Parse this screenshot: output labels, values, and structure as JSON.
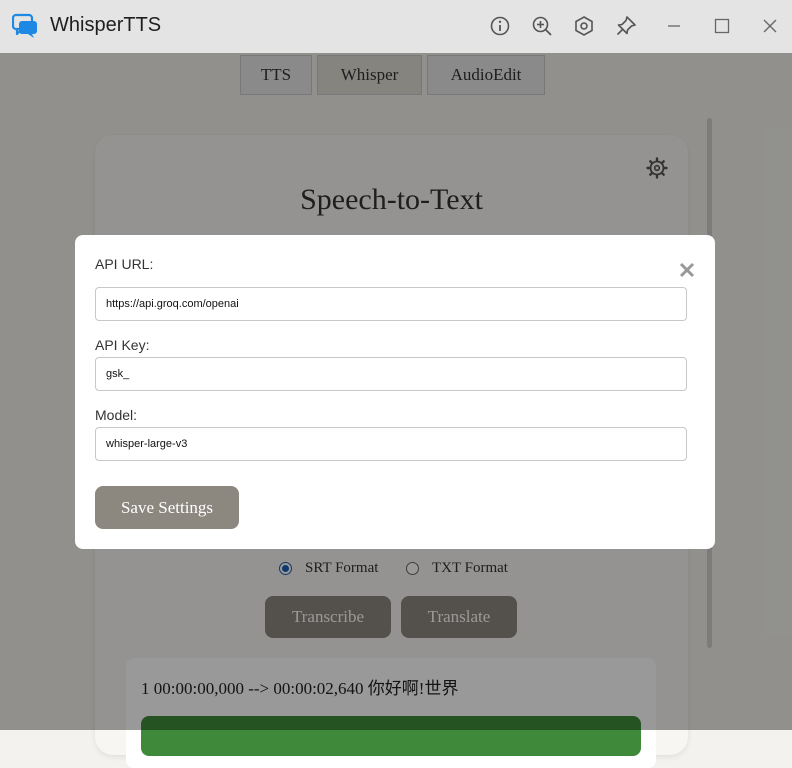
{
  "window": {
    "title": "WhisperTTS",
    "accent": "#1e88e5",
    "icons": [
      "info-icon",
      "zoom-in-icon",
      "settings-icon",
      "pin-icon",
      "minimize-icon",
      "maximize-icon",
      "close-icon"
    ]
  },
  "tabs": [
    {
      "label": "TTS",
      "active": false
    },
    {
      "label": "Whisper",
      "active": true
    },
    {
      "label": "AudioEdit",
      "active": false
    }
  ],
  "card": {
    "title": "Speech-to-Text",
    "formats": [
      {
        "label": "SRT Format",
        "checked": true
      },
      {
        "label": "TXT Format",
        "checked": false
      }
    ],
    "transcribe_label": "Transcribe",
    "translate_label": "Translate",
    "output_text": "1 00:00:00,000 --> 00:00:02,640 你好啊!世界",
    "output_bar_color": "#3f8a3a"
  },
  "modal": {
    "api_url_label": "API URL:",
    "api_url_value": "https://api.groq.com/openai",
    "api_key_label": "API Key:",
    "api_key_value": "gsk_",
    "model_label": "Model:",
    "model_value": "whisper-large-v3",
    "save_label": "Save Settings",
    "button_color": "#8c887f"
  }
}
